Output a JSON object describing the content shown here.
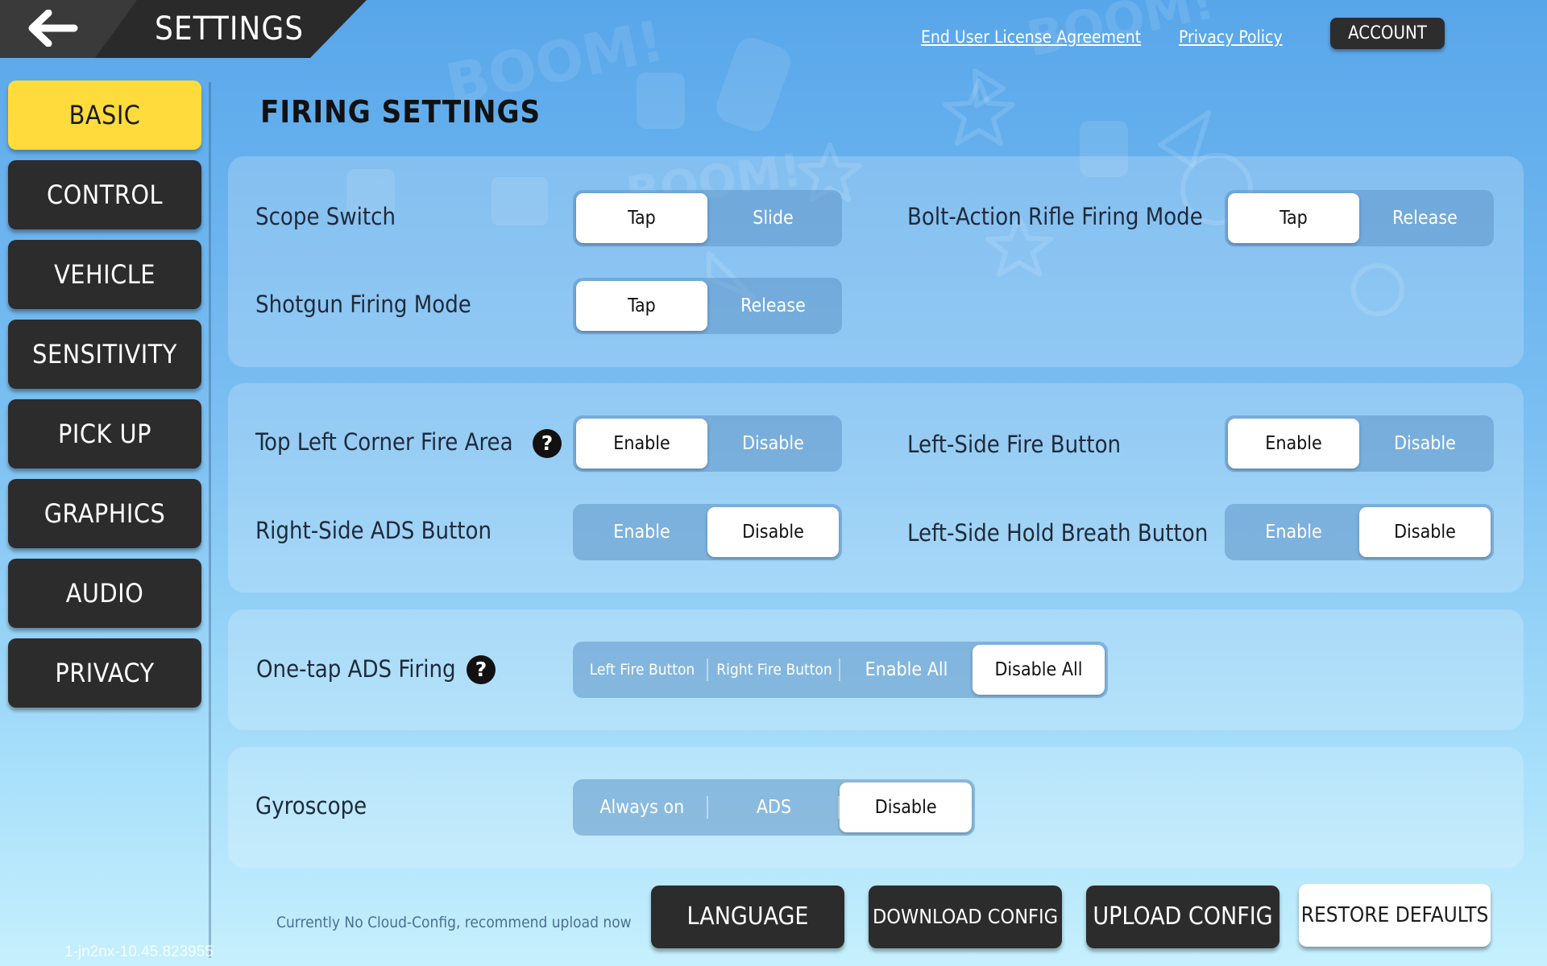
{
  "header": {
    "title": "SETTINGS",
    "links": [
      "End User License Agreement",
      "Privacy Policy"
    ],
    "account_label": "ACCOUNT"
  },
  "sidebar": {
    "items": [
      {
        "label": "BASIC",
        "active": true
      },
      {
        "label": "CONTROL"
      },
      {
        "label": "VEHICLE"
      },
      {
        "label": "SENSITIVITY"
      },
      {
        "label": "PICK UP"
      },
      {
        "label": "GRAPHICS"
      },
      {
        "label": "AUDIO"
      },
      {
        "label": "PRIVACY"
      }
    ]
  },
  "main": {
    "section_title": "FIRING SETTINGS",
    "settings": {
      "scope_switch": {
        "label": "Scope Switch",
        "options": [
          "Tap",
          "Slide"
        ],
        "selected": "Tap"
      },
      "bolt_action": {
        "label": "Bolt-Action Rifle Firing Mode",
        "options": [
          "Tap",
          "Release"
        ],
        "selected": "Tap"
      },
      "shotgun": {
        "label": "Shotgun Firing Mode",
        "options": [
          "Tap",
          "Release"
        ],
        "selected": "Tap"
      },
      "top_left_fire": {
        "label": "Top Left Corner Fire Area",
        "help": "?",
        "options": [
          "Enable",
          "Disable"
        ],
        "selected": "Enable"
      },
      "left_fire_button": {
        "label": "Left-Side Fire Button",
        "options": [
          "Enable",
          "Disable"
        ],
        "selected": "Enable"
      },
      "right_ads": {
        "label": "Right-Side ADS Button",
        "options": [
          "Enable",
          "Disable"
        ],
        "selected": "Disable"
      },
      "left_hold_breath": {
        "label": "Left-Side Hold Breath Button",
        "options": [
          "Enable",
          "Disable"
        ],
        "selected": "Disable"
      },
      "one_tap_ads": {
        "label": "One-tap ADS Firing",
        "help": "?",
        "options": [
          "Left Fire Button",
          "Right Fire Button",
          "Enable All",
          "Disable All"
        ],
        "selected": "Disable All"
      },
      "gyroscope": {
        "label": "Gyroscope",
        "options": [
          "Always on",
          "ADS",
          "Disable"
        ],
        "selected": "Disable"
      }
    }
  },
  "footer": {
    "cloud_message": "Currently No Cloud-Config, recommend upload now",
    "buttons": [
      "LANGUAGE",
      "DOWNLOAD CONFIG",
      "UPLOAD CONFIG",
      "RESTORE DEFAULTS"
    ],
    "version": "1-jn2nx-10.45.823955"
  },
  "colors": {
    "active_nav": "#ffdc3c",
    "button_dark": "#2c2c2c",
    "background_top": "#58a6ea",
    "background_bottom": "#c6f0fd"
  }
}
